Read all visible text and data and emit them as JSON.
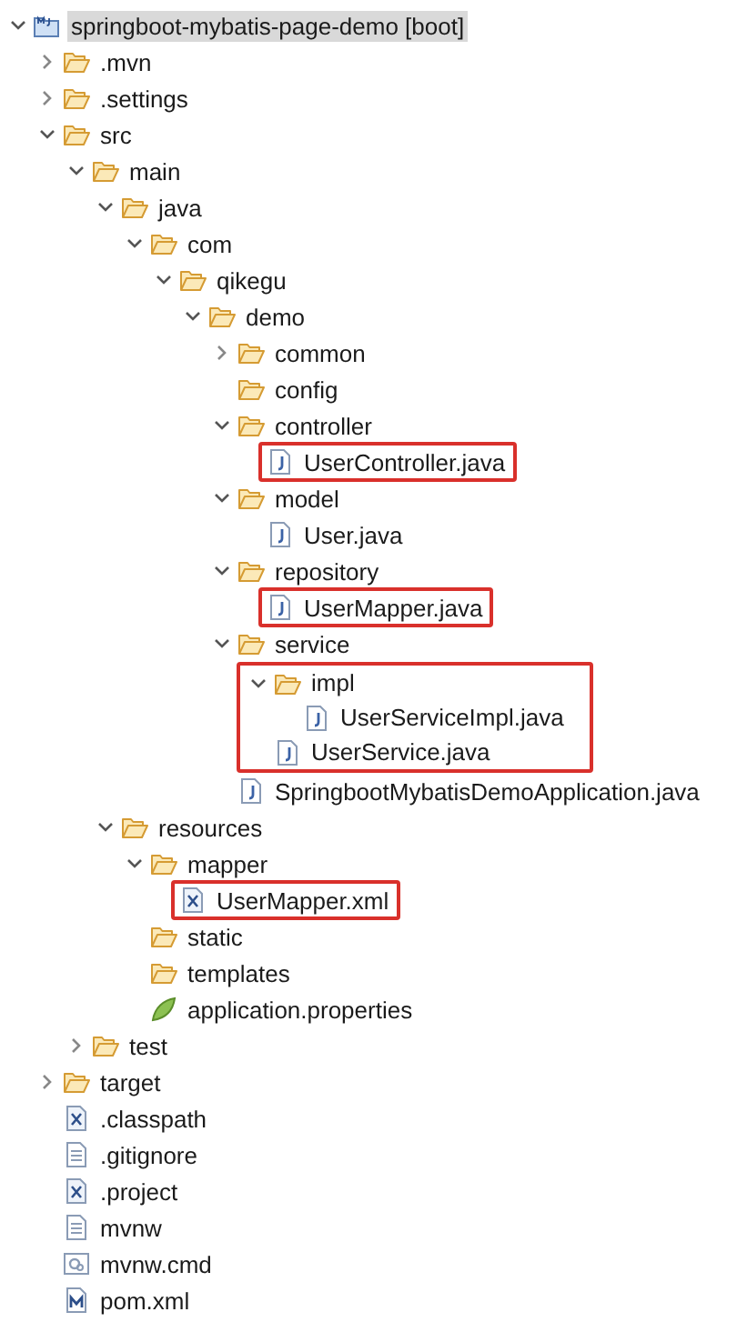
{
  "tree": [
    {
      "kind": "project",
      "label": "springboot-mybatis-page-demo [boot]",
      "selected": true,
      "expanded": true,
      "children": [
        {
          "kind": "folder",
          "label": ".mvn",
          "selected": false,
          "expanded": false
        },
        {
          "kind": "folder",
          "label": ".settings",
          "selected": false,
          "expanded": false
        },
        {
          "kind": "folder",
          "label": "src",
          "selected": false,
          "expanded": true,
          "children": [
            {
              "kind": "folder",
              "label": "main",
              "selected": false,
              "expanded": true,
              "children": [
                {
                  "kind": "folder",
                  "label": "java",
                  "selected": false,
                  "expanded": true,
                  "children": [
                    {
                      "kind": "folder",
                      "label": "com",
                      "selected": false,
                      "expanded": true,
                      "children": [
                        {
                          "kind": "folder",
                          "label": "qikegu",
                          "selected": false,
                          "expanded": true,
                          "children": [
                            {
                              "kind": "folder",
                              "label": "demo",
                              "selected": false,
                              "expanded": true,
                              "children": [
                                {
                                  "kind": "folder",
                                  "label": "common",
                                  "selected": false,
                                  "expanded": false
                                },
                                {
                                  "kind": "folder",
                                  "label": "config",
                                  "selected": false
                                },
                                {
                                  "kind": "folder",
                                  "label": "controller",
                                  "selected": false,
                                  "expanded": true,
                                  "children": [
                                    {
                                      "kind": "java",
                                      "label": "UserController.java",
                                      "selected": false,
                                      "highlighted": true
                                    }
                                  ]
                                },
                                {
                                  "kind": "folder",
                                  "label": "model",
                                  "selected": false,
                                  "expanded": true,
                                  "children": [
                                    {
                                      "kind": "java",
                                      "label": "User.java",
                                      "selected": false,
                                      "highlighted": false
                                    }
                                  ]
                                },
                                {
                                  "kind": "folder",
                                  "label": "repository",
                                  "selected": false,
                                  "expanded": true,
                                  "children": [
                                    {
                                      "kind": "java",
                                      "label": "UserMapper.java",
                                      "selected": false,
                                      "highlighted": true
                                    }
                                  ]
                                },
                                {
                                  "kind": "folder",
                                  "label": "service",
                                  "selected": false,
                                  "expanded": true,
                                  "children": [
                                    {
                                      "kind": "group",
                                      "highlighted": true,
                                      "children": [
                                        {
                                          "kind": "folder",
                                          "label": "impl",
                                          "selected": false,
                                          "expanded": true,
                                          "children": [
                                            {
                                              "kind": "java",
                                              "label": "UserServiceImpl.java",
                                              "selected": false,
                                              "highlighted": false
                                            }
                                          ]
                                        },
                                        {
                                          "kind": "java",
                                          "label": "UserService.java",
                                          "selected": false,
                                          "highlighted": false
                                        }
                                      ]
                                    }
                                  ]
                                },
                                {
                                  "kind": "java",
                                  "label": "SpringbootMybatisDemoApplication.java",
                                  "selected": false,
                                  "highlighted": false
                                }
                              ]
                            }
                          ]
                        }
                      ]
                    }
                  ]
                },
                {
                  "kind": "folder",
                  "label": "resources",
                  "selected": false,
                  "expanded": true,
                  "children": [
                    {
                      "kind": "folder",
                      "label": "mapper",
                      "selected": false,
                      "expanded": true,
                      "children": [
                        {
                          "kind": "xml",
                          "label": "UserMapper.xml",
                          "selected": false,
                          "highlighted": true
                        }
                      ]
                    },
                    {
                      "kind": "folder",
                      "label": "static",
                      "selected": false
                    },
                    {
                      "kind": "folder",
                      "label": "templates",
                      "selected": false
                    },
                    {
                      "kind": "properties",
                      "label": "application.properties",
                      "selected": false,
                      "highlighted": false
                    }
                  ]
                }
              ]
            },
            {
              "kind": "folder",
              "label": "test",
              "selected": false,
              "expanded": false
            }
          ]
        },
        {
          "kind": "folder",
          "label": "target",
          "selected": false,
          "expanded": false
        },
        {
          "kind": "xml",
          "label": ".classpath",
          "selected": false,
          "highlighted": false
        },
        {
          "kind": "text",
          "label": ".gitignore",
          "selected": false,
          "highlighted": false
        },
        {
          "kind": "xml",
          "label": ".project",
          "selected": false,
          "highlighted": false
        },
        {
          "kind": "text",
          "label": "mvnw",
          "selected": false,
          "highlighted": false
        },
        {
          "kind": "cmd",
          "label": "mvnw.cmd",
          "selected": false,
          "highlighted": false
        },
        {
          "kind": "pom",
          "label": "pom.xml",
          "selected": false,
          "highlighted": false
        }
      ]
    }
  ]
}
